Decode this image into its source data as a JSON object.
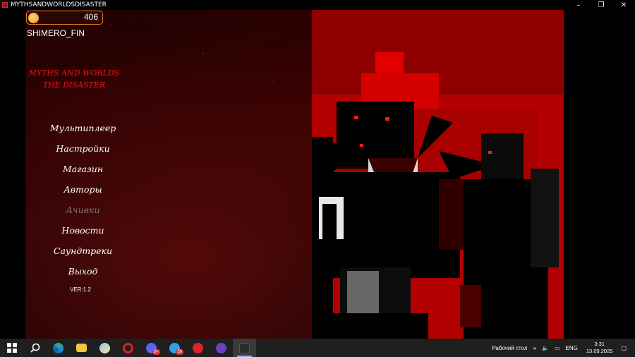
{
  "window": {
    "title": "MYTHSANDWORLDSDISASTER",
    "controls": [
      "–",
      "❐",
      "✕"
    ]
  },
  "hud": {
    "coins": "406",
    "username": "SHIMERO_FIN"
  },
  "logo": {
    "line1": "MYTHS AND WORLDS",
    "line2": "THE DISASTER"
  },
  "menu": {
    "items": [
      {
        "label": "Мультиплеер",
        "enabled": true
      },
      {
        "label": "Настройки",
        "enabled": true
      },
      {
        "label": "Магазин",
        "enabled": true
      },
      {
        "label": "Авторы",
        "enabled": true
      },
      {
        "label": "Ачивки",
        "enabled": false
      },
      {
        "label": "Новости",
        "enabled": true
      },
      {
        "label": "Саундтреки",
        "enabled": true
      },
      {
        "label": "Выход",
        "enabled": true
      }
    ],
    "version": "VER:1.2"
  },
  "taskbar": {
    "apps": [
      {
        "name": "windows-start-icon"
      },
      {
        "name": "search-icon"
      },
      {
        "name": "edge-icon"
      },
      {
        "name": "file-explorer-icon"
      },
      {
        "name": "paint-icon"
      },
      {
        "name": "opera-icon"
      },
      {
        "name": "discord-icon",
        "badge": "9+"
      },
      {
        "name": "telegram-icon",
        "badge": "59"
      },
      {
        "name": "media-player-icon"
      },
      {
        "name": "game-launcher-icon"
      },
      {
        "name": "game-app-icon",
        "active": true
      }
    ],
    "tray": {
      "desktop_label": "Рабочий стол",
      "language": "ENG",
      "time": "3:31",
      "date": "13.09.2025"
    }
  },
  "colors": {
    "accent_red": "#d41818",
    "coin_border": "#e07a1e",
    "art_red": "#c00000"
  }
}
